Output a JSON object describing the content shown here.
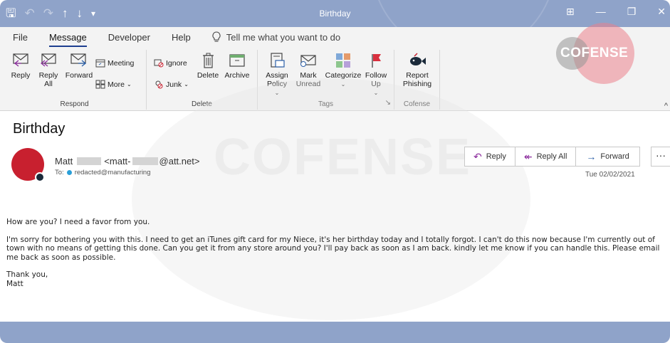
{
  "window": {
    "title": "Birthday",
    "controls": [
      "⊞",
      "—",
      "❐",
      "✕"
    ]
  },
  "ribbon_tabs": {
    "file": "File",
    "message": "Message",
    "developer": "Developer",
    "help": "Help",
    "tell_me": "Tell me what you want to do"
  },
  "ribbon": {
    "respond": {
      "label": "Respond",
      "reply": "Reply",
      "reply_all": "Reply All",
      "forward": "Forward",
      "meeting": "Meeting",
      "more": "More"
    },
    "delete": {
      "label": "Delete",
      "ignore": "Ignore",
      "junk": "Junk",
      "delete": "Delete",
      "archive": "Archive"
    },
    "tags": {
      "label": "Tags",
      "assign_policy": "Assign Policy",
      "mark_unread": "Mark Unread",
      "categorize": "Categorize",
      "follow_up": "Follow Up"
    },
    "cofense": {
      "label": "Cofense",
      "report_phishing": "Report Phishing"
    },
    "collapse": "^"
  },
  "logo": {
    "text": "COFENSE"
  },
  "watermark": {
    "text": "COFENSE"
  },
  "message": {
    "subject": "Birthday",
    "from_name": "Matt",
    "from_email_prefix": "<matt-",
    "from_email_suffix": "@att.net>",
    "to_label": "To:",
    "to_value": "redacted@manufacturing",
    "date": "Tue 02/02/2021",
    "actions": {
      "reply": "Reply",
      "reply_all": "Reply All",
      "forward": "Forward",
      "more": "···"
    },
    "body": {
      "line1": "How are you? I need a favor from you.",
      "line2": "I'm sorry for bothering you with this. I need to get an iTunes gift card for my Niece, it's her birthday today and I totally forgot. I can't do this now because I'm currently out of town with no means of getting this done. Can you get it from any store around you? I'll pay back as soon as I am back. kindly let me know if you can handle this. Please email me back as soon as possible.",
      "sign_off": "Thank you,",
      "signature": "Matt"
    }
  },
  "colors": {
    "title_bar": "#8fa3c9",
    "ribbon_bg": "#f3f3f3",
    "avatar": "#c8202f",
    "accent": "#2b5fa8"
  }
}
